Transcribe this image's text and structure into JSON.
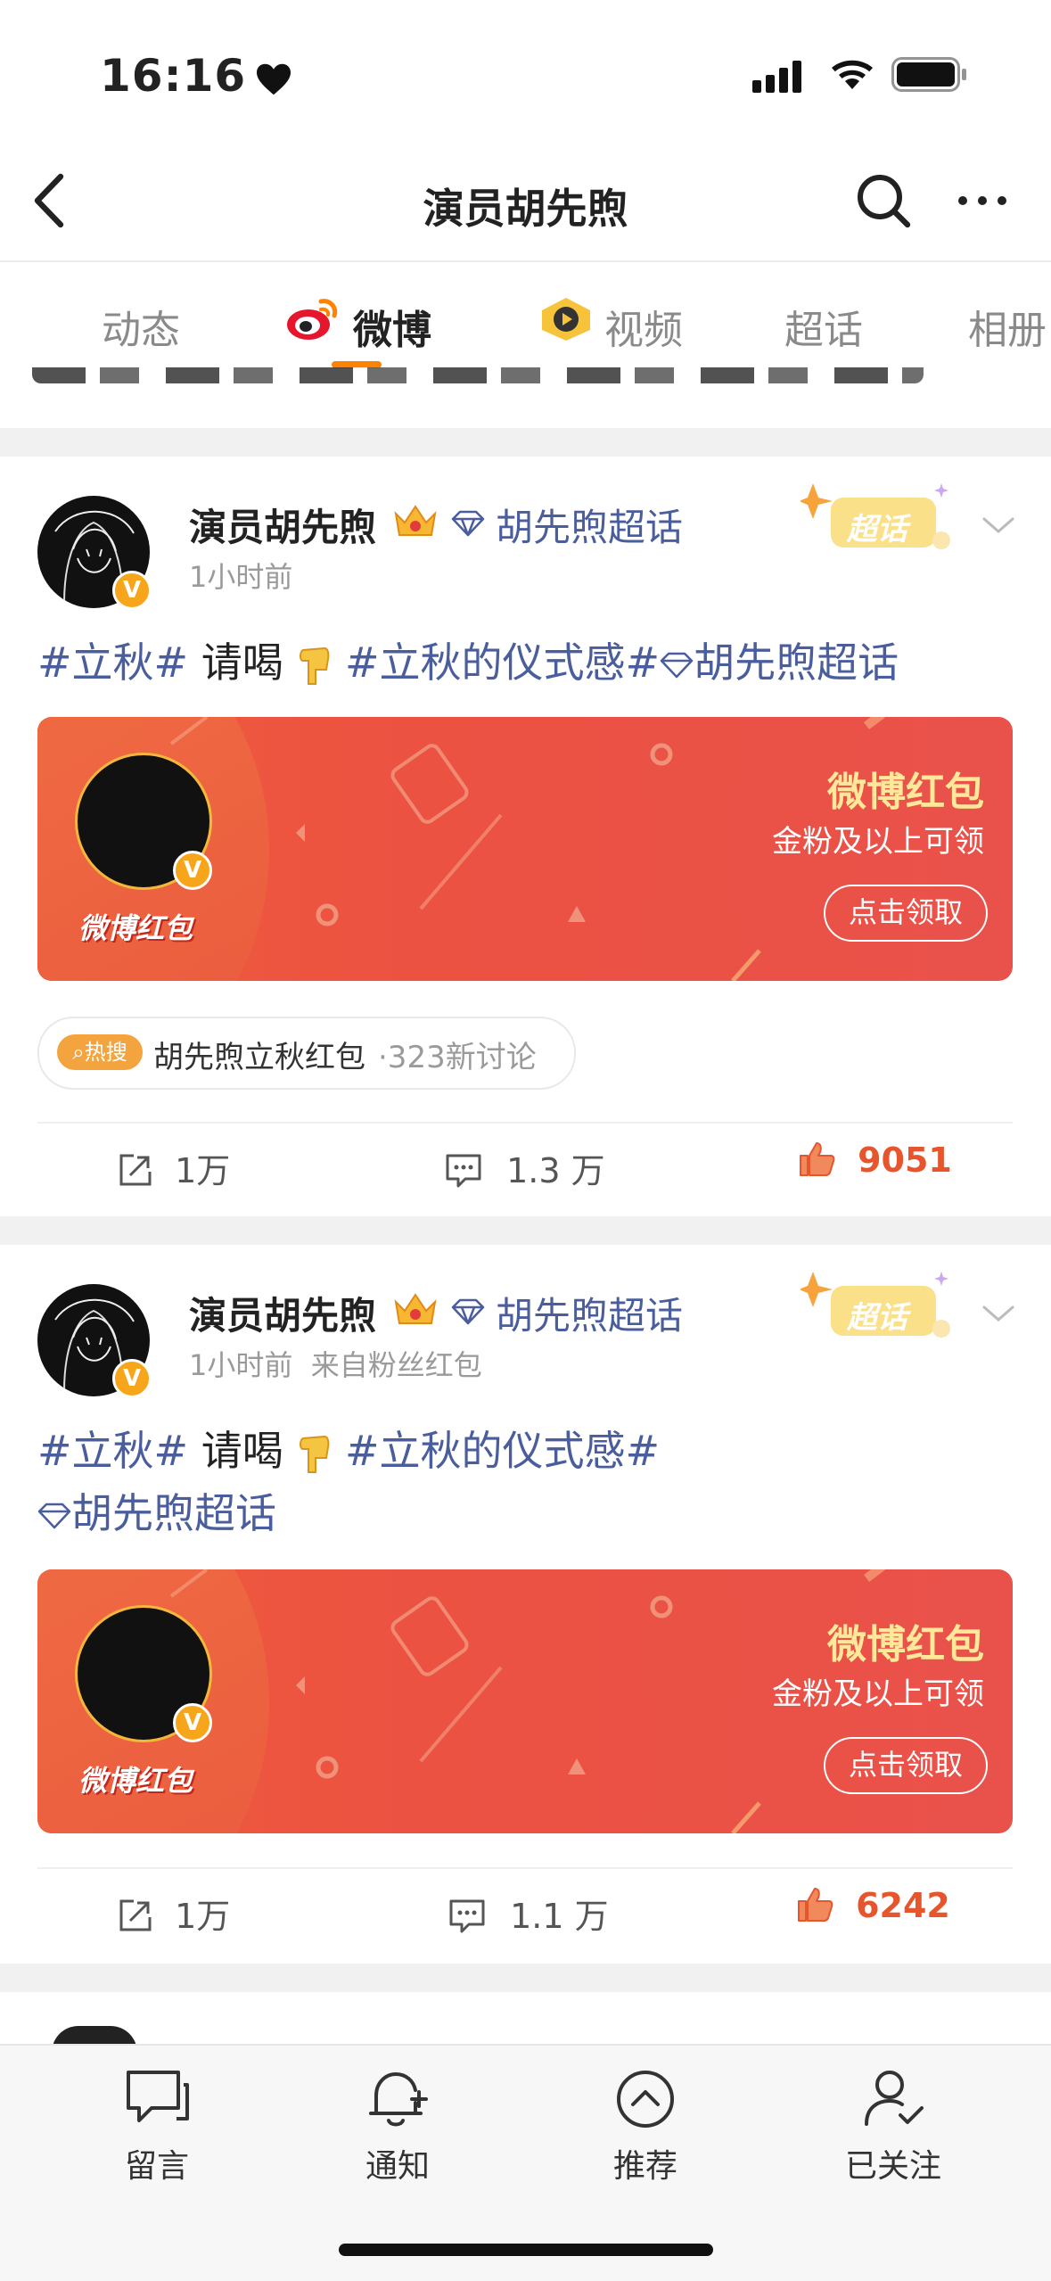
{
  "status_bar": {
    "time": "16:16"
  },
  "nav": {
    "title": "演员胡先煦"
  },
  "tabs": [
    {
      "label": "动态"
    },
    {
      "label": "微博"
    },
    {
      "label": "视频"
    },
    {
      "label": "超话"
    },
    {
      "label": "相册"
    }
  ],
  "posts": [
    {
      "username": "演员胡先煦",
      "chaohua": "胡先煦超话",
      "time": "1小时前",
      "source": "",
      "text": {
        "tag1": "#立秋#",
        "mid": " 请喝 ",
        "tag2": "#立秋的仪式感#",
        "tag3": "胡先煦超话"
      },
      "card": {
        "logo": "微博红包",
        "title": "微博红包",
        "subtitle": "金粉及以上可领",
        "button": "点击领取"
      },
      "hot": {
        "badge": "热搜",
        "text": "胡先煦立秋红包",
        "sub": "·323新讨论"
      },
      "actions": {
        "repost": "1万",
        "comment": "1.3 万",
        "like": "9051"
      }
    },
    {
      "username": "演员胡先煦",
      "chaohua": "胡先煦超话",
      "time": "1小时前",
      "source": "来自粉丝红包",
      "text": {
        "tag1": "#立秋#",
        "mid": " 请喝 ",
        "tag2": "#立秋的仪式感#",
        "tag3": "胡先煦超话"
      },
      "card": {
        "logo": "微博红包",
        "title": "微博红包",
        "subtitle": "金粉及以上可领",
        "button": "点击领取"
      },
      "actions": {
        "repost": "1万",
        "comment": "1.1 万",
        "like": "6242"
      }
    }
  ],
  "chaohua_badge": "超话",
  "verified_mark": "V",
  "tabbar": [
    {
      "label": "留言",
      "icon": "message-icon"
    },
    {
      "label": "通知",
      "icon": "bell-icon"
    },
    {
      "label": "推荐",
      "icon": "chevron-up-circle-icon"
    },
    {
      "label": "已关注",
      "icon": "user-check-icon"
    }
  ],
  "colors": {
    "accent": "#ff8200",
    "link": "#4a5d9c",
    "like": "#e7552c",
    "card": "#ec5242"
  }
}
